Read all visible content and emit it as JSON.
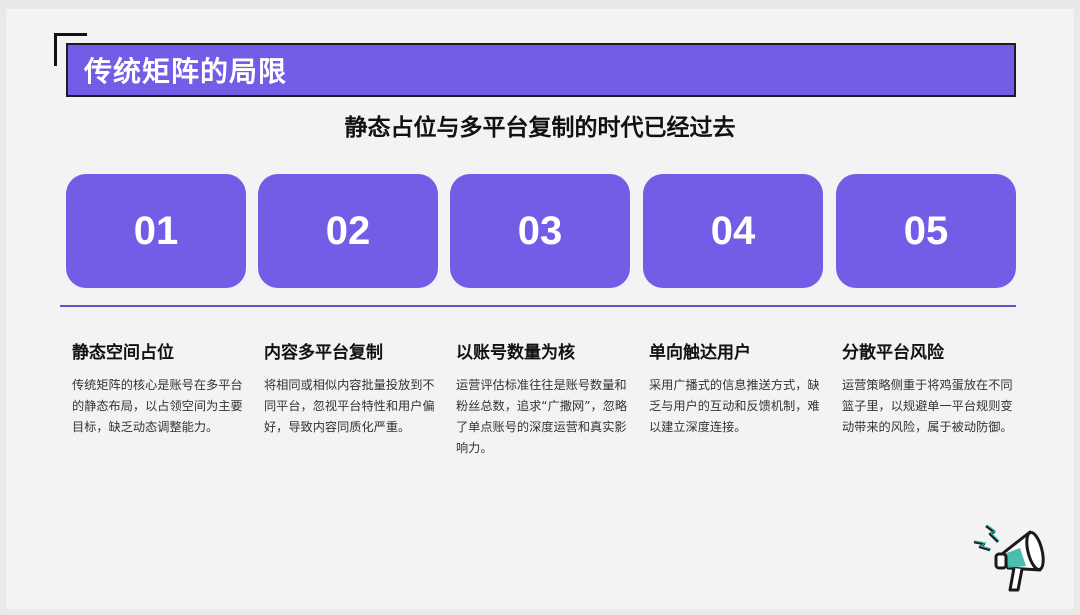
{
  "title": "传统矩阵的局限",
  "subtitle": "静态占位与多平台复制的时代已经过去",
  "cards": [
    {
      "num": "01",
      "heading": "静态空间占位",
      "desc": "传统矩阵的核心是账号在多平台的静态布局，以占领空间为主要目标，缺乏动态调整能力。"
    },
    {
      "num": "02",
      "heading": "内容多平台复制",
      "desc": "将相同或相似内容批量投放到不同平台，忽视平台特性和用户偏好，导致内容同质化严重。"
    },
    {
      "num": "03",
      "heading": "以账号数量为核",
      "desc": "运营评估标准往往是账号数量和粉丝总数，追求“广撒网”，忽略了单点账号的深度运营和真实影响力。"
    },
    {
      "num": "04",
      "heading": "单向触达用户",
      "desc": "采用广播式的信息推送方式，缺乏与用户的互动和反馈机制，难以建立深度连接。"
    },
    {
      "num": "05",
      "heading": "分散平台风险",
      "desc": "运营策略侧重于将鸡蛋放在不同篮子里，以规避单一平台规则变动带来的风险，属于被动防御。"
    }
  ],
  "colors": {
    "accent": "#735de6",
    "divider": "#5f55c8",
    "teal": "#2bb3a3"
  },
  "icons": {
    "corner": "corner-bracket-icon",
    "decor": "megaphone-icon"
  }
}
